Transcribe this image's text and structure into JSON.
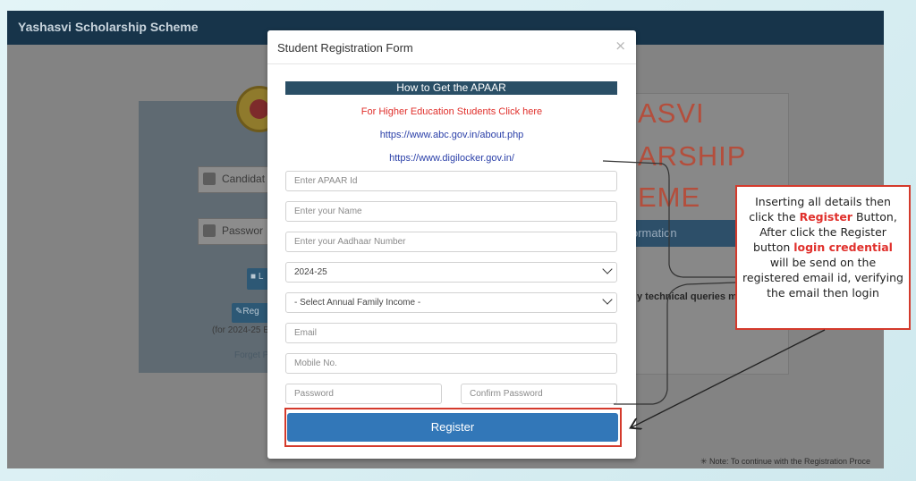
{
  "app": {
    "title": "Yashasvi Scholarship Scheme"
  },
  "background": {
    "candidate_label": "Candidat",
    "password_label": "Passwor",
    "login_button": "L",
    "register_button": "Reg",
    "session_note": "(for 2024-25 E",
    "forgot_link": "Forget P",
    "big_title_lines": [
      "ASVI",
      "ARSHIP",
      "EME"
    ],
    "info_bar": "ormation",
    "tech_queries": "y technical queries mo",
    "footer_note": "Note: To continue with the Registration Proce"
  },
  "modal": {
    "title": "Student Registration Form",
    "close": "×",
    "apaar_heading": "How to Get the APAAR",
    "higher_ed_link": "For Higher Education Students Click here",
    "abc_link": "https://www.abc.gov.in/about.php",
    "digilocker_link": "https://www.digilocker.gov.in/",
    "fields": {
      "apaar_placeholder": "Enter APAAR Id",
      "name_placeholder": "Enter your Name",
      "aadhaar_placeholder": "Enter your Aadhaar Number",
      "session_value": "2024-25",
      "income_value": "- Select Annual Family Income -",
      "email_placeholder": "Email",
      "mobile_placeholder": "Mobile No.",
      "password_placeholder": "Password",
      "confirm_password_placeholder": "Confirm Password"
    },
    "register_label": "Register"
  },
  "callout": {
    "text_1": "Inserting all details then click the ",
    "register_word": "Register",
    "text_2": " Button, After click the Register button ",
    "login_word": "login credential",
    "text_3": " will be send on the registered email id, verifying the email then login"
  },
  "colors": {
    "accent_red": "#d43a2c",
    "header_blue": "#17344a",
    "register_blue": "#3277b8"
  }
}
